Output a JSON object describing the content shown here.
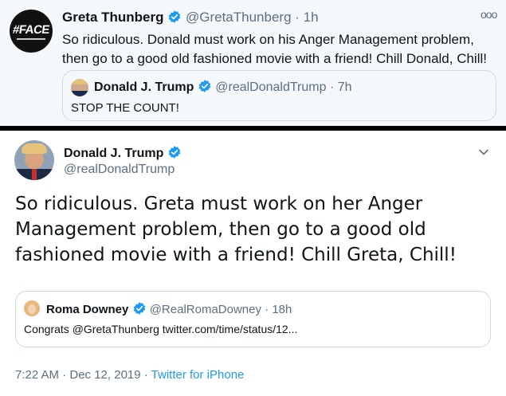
{
  "top_tweet": {
    "author_name": "Greta Thunberg",
    "author_handle": "@GretaThunberg",
    "time": "· 1h",
    "more_label": "ooo",
    "avatar_text": "#FACE",
    "text": "So ridiculous. Donald must work on his Anger Management problem, then go to a good old fashioned movie with a friend! Chill Donald, Chill!",
    "quoted": {
      "author_name": "Donald J. Trump",
      "author_handle": "@realDonaldTrump",
      "time": "· 7h",
      "text": "STOP THE COUNT!"
    }
  },
  "bottom_tweet": {
    "author_name": "Donald J. Trump",
    "author_handle": "@realDonaldTrump",
    "text": "So ridiculous. Greta must work on her Anger Management problem, then go to a good old fashioned movie with a friend! Chill Greta, Chill!",
    "quoted": {
      "author_name": "Roma Downey",
      "author_handle": "@RealRomaDowney",
      "time": "· 18h",
      "text": "Congrats @GretaThunberg twitter.com/time/status/12..."
    },
    "footer": {
      "timestamp": "7:22 AM · Dec 12, 2019 · ",
      "source": "Twitter for iPhone"
    }
  },
  "icons": {
    "verified": "verified-badge-icon",
    "more": "more-icon",
    "chevron": "chevron-down-icon"
  },
  "colors": {
    "verified_blue": "#1d9bf0",
    "secondary_text": "#5b7083",
    "top_background": "#f5f8fa"
  }
}
